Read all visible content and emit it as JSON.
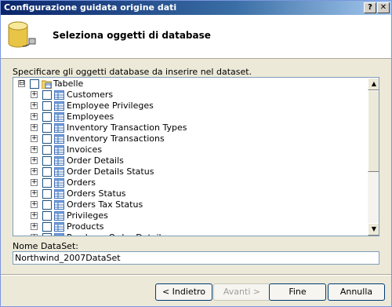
{
  "window": {
    "title": "Configurazione guidata origine dati",
    "help_label": "?",
    "close_label": "✕"
  },
  "header": {
    "title": "Seleziona oggetti di database",
    "icon": "database-icon"
  },
  "instruction": "Specificare gli oggetti database da inserire nel dataset.",
  "tree": {
    "root": {
      "label": "Tabelle",
      "expander": "⊟",
      "checked": false,
      "icon": "folder-table-icon"
    },
    "items": [
      {
        "label": "Customers",
        "expander": "+",
        "checked": false,
        "icon": "table-icon"
      },
      {
        "label": "Employee Privileges",
        "expander": "+",
        "checked": false,
        "icon": "table-icon"
      },
      {
        "label": "Employees",
        "expander": "+",
        "checked": false,
        "icon": "table-icon"
      },
      {
        "label": "Inventory Transaction Types",
        "expander": "+",
        "checked": false,
        "icon": "table-icon"
      },
      {
        "label": "Inventory Transactions",
        "expander": "+",
        "checked": false,
        "icon": "table-icon"
      },
      {
        "label": "Invoices",
        "expander": "+",
        "checked": false,
        "icon": "table-icon"
      },
      {
        "label": "Order Details",
        "expander": "+",
        "checked": false,
        "icon": "table-icon"
      },
      {
        "label": "Order Details Status",
        "expander": "+",
        "checked": false,
        "icon": "table-icon"
      },
      {
        "label": "Orders",
        "expander": "+",
        "checked": false,
        "icon": "table-icon"
      },
      {
        "label": "Orders Status",
        "expander": "+",
        "checked": false,
        "icon": "table-icon"
      },
      {
        "label": "Orders Tax Status",
        "expander": "+",
        "checked": false,
        "icon": "table-icon"
      },
      {
        "label": "Privileges",
        "expander": "+",
        "checked": false,
        "icon": "table-icon"
      },
      {
        "label": "Products",
        "expander": "+",
        "checked": false,
        "icon": "table-icon"
      },
      {
        "label": "Purchase Order Details",
        "expander": "+",
        "checked": false,
        "icon": "table-icon"
      }
    ]
  },
  "scrollbar": {
    "up_label": "▲",
    "down_label": "▼"
  },
  "dataset": {
    "label": "Nome DataSet:",
    "value": "Northwind_2007DataSet"
  },
  "buttons": {
    "back": "< Indietro",
    "next": "Avanti >",
    "finish": "Fine",
    "cancel": "Annulla"
  },
  "colors": {
    "title_bar_start": "#0a246a",
    "title_bar_end": "#a6caf0",
    "dialog_background": "#ece9d8"
  }
}
